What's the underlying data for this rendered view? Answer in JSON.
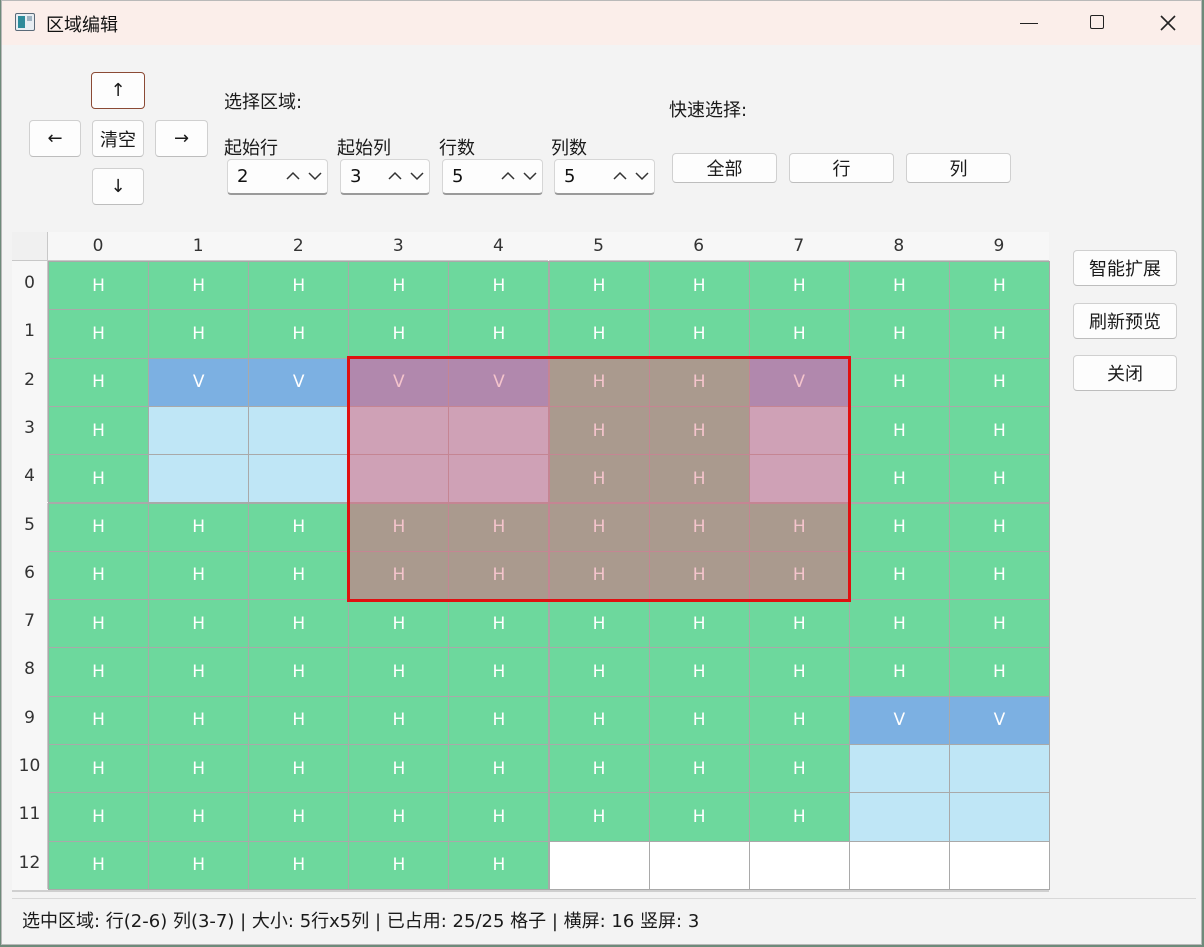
{
  "window": {
    "title": "区域编辑"
  },
  "nav": {
    "up": "↑",
    "left": "←",
    "clear": "清空",
    "right": "→",
    "down": "↓"
  },
  "select_area": {
    "label": "选择区域:",
    "start_row_label": "起始行",
    "start_col_label": "起始列",
    "rows_label": "行数",
    "cols_label": "列数",
    "start_row": "2",
    "start_col": "3",
    "rows": "5",
    "cols": "5"
  },
  "quick_select": {
    "label": "快速选择:",
    "all": "全部",
    "row": "行",
    "col": "列"
  },
  "side_buttons": {
    "smart_expand": "智能扩展",
    "refresh_preview": "刷新预览",
    "close": "关闭"
  },
  "grid": {
    "columns": [
      "0",
      "1",
      "2",
      "3",
      "4",
      "5",
      "6",
      "7",
      "8",
      "9"
    ],
    "rows": [
      "0",
      "1",
      "2",
      "3",
      "4",
      "5",
      "6",
      "7",
      "8",
      "9",
      "10",
      "11",
      "12"
    ],
    "cells": [
      [
        "H",
        "H",
        "H",
        "H",
        "H",
        "H",
        "H",
        "H",
        "H",
        "H"
      ],
      [
        "H",
        "H",
        "H",
        "H",
        "H",
        "H",
        "H",
        "H",
        "H",
        "H"
      ],
      [
        "H",
        "V",
        "V",
        "V",
        "V",
        "H",
        "H",
        "V",
        "H",
        "H"
      ],
      [
        "H",
        "",
        "",
        "",
        "",
        "H",
        "H",
        "",
        "H",
        "H"
      ],
      [
        "H",
        "",
        "",
        "",
        "",
        "H",
        "H",
        "",
        "H",
        "H"
      ],
      [
        "H",
        "H",
        "H",
        "H",
        "H",
        "H",
        "H",
        "H",
        "H",
        "H"
      ],
      [
        "H",
        "H",
        "H",
        "H",
        "H",
        "H",
        "H",
        "H",
        "H",
        "H"
      ],
      [
        "H",
        "H",
        "H",
        "H",
        "H",
        "H",
        "H",
        "H",
        "H",
        "H"
      ],
      [
        "H",
        "H",
        "H",
        "H",
        "H",
        "H",
        "H",
        "H",
        "H",
        "H"
      ],
      [
        "H",
        "H",
        "H",
        "H",
        "H",
        "H",
        "H",
        "H",
        "V",
        "V"
      ],
      [
        "H",
        "H",
        "H",
        "H",
        "H",
        "H",
        "H",
        "H",
        "",
        ""
      ],
      [
        "H",
        "H",
        "H",
        "H",
        "H",
        "H",
        "H",
        "H",
        "",
        ""
      ],
      [
        "H",
        "H",
        "H",
        "H",
        "H",
        "",
        "",
        "",
        "",
        ""
      ]
    ],
    "cell_types": [
      [
        "h",
        "h",
        "h",
        "h",
        "h",
        "h",
        "h",
        "h",
        "h",
        "h"
      ],
      [
        "h",
        "h",
        "h",
        "h",
        "h",
        "h",
        "h",
        "h",
        "h",
        "h"
      ],
      [
        "h",
        "v",
        "v",
        "v",
        "v",
        "h",
        "h",
        "v",
        "h",
        "h"
      ],
      [
        "h",
        "b",
        "b",
        "b",
        "b",
        "h",
        "h",
        "b",
        "h",
        "h"
      ],
      [
        "h",
        "b",
        "b",
        "b",
        "b",
        "h",
        "h",
        "b",
        "h",
        "h"
      ],
      [
        "h",
        "h",
        "h",
        "h",
        "h",
        "h",
        "h",
        "h",
        "h",
        "h"
      ],
      [
        "h",
        "h",
        "h",
        "h",
        "h",
        "h",
        "h",
        "h",
        "h",
        "h"
      ],
      [
        "h",
        "h",
        "h",
        "h",
        "h",
        "h",
        "h",
        "h",
        "h",
        "h"
      ],
      [
        "h",
        "h",
        "h",
        "h",
        "h",
        "h",
        "h",
        "h",
        "h",
        "h"
      ],
      [
        "h",
        "h",
        "h",
        "h",
        "h",
        "h",
        "h",
        "h",
        "v",
        "v"
      ],
      [
        "h",
        "h",
        "h",
        "h",
        "h",
        "h",
        "h",
        "h",
        "b",
        "b"
      ],
      [
        "h",
        "h",
        "h",
        "h",
        "h",
        "h",
        "h",
        "h",
        "b",
        "b"
      ],
      [
        "h",
        "h",
        "h",
        "h",
        "h",
        "e",
        "e",
        "e",
        "e",
        "e"
      ]
    ],
    "colors": {
      "horizontal": "#6dd89d",
      "vertical": "#7cb0e2",
      "vertical_body": "#bfe6f6",
      "empty": "#ffffff",
      "selection_border": "#e01010"
    }
  },
  "status": {
    "text": "选中区域: 行(2-6) 列(3-7) | 大小: 5行x5列 | 已占用: 25/25 格子 | 横屏: 16 竖屏: 3"
  }
}
